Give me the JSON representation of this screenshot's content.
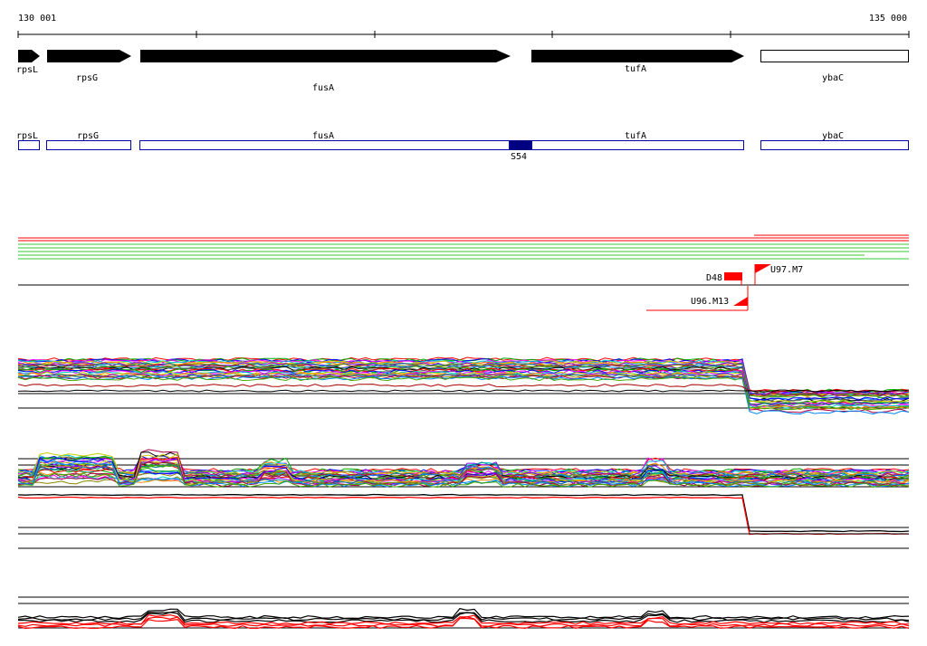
{
  "ruler": {
    "start_label": "130 001",
    "end_label": "135 000"
  },
  "genes": [
    {
      "name": "rpsL",
      "style": "arrow"
    },
    {
      "name": "rpsG",
      "style": "arrow"
    },
    {
      "name": "fusA",
      "style": "arrow"
    },
    {
      "name": "tufA",
      "style": "arrow"
    },
    {
      "name": "ybaC",
      "style": "open-box"
    }
  ],
  "gene_boxes": [
    {
      "name": "rpsL"
    },
    {
      "name": "rpsG"
    },
    {
      "name": "fusA"
    },
    {
      "name": "tufA"
    },
    {
      "name": "ybaC"
    }
  ],
  "highlight": {
    "label": "S54",
    "color": "#000080"
  },
  "markers": [
    {
      "label": "D48",
      "color": "#ff0000"
    },
    {
      "label": "U97.M7",
      "color": "#ff0000"
    },
    {
      "label": "U96.M13",
      "color": "#ff0000"
    }
  ],
  "colors": {
    "box_outline": "#0000aa",
    "track_red": "#ff0000",
    "track_green": "#33cc33",
    "baseline": "#000000"
  }
}
